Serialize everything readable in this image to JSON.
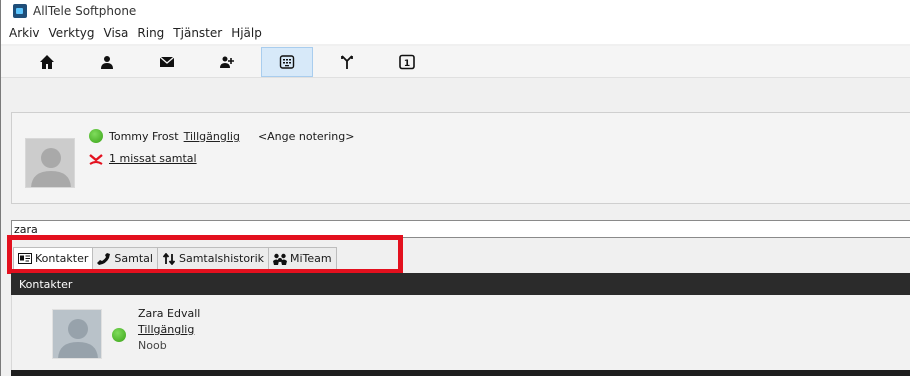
{
  "window": {
    "title": "AllTele Softphone"
  },
  "menu": [
    "Arkiv",
    "Verktyg",
    "Visa",
    "Ring",
    "Tjänster",
    "Hjälp"
  ],
  "toolbar": [
    {
      "icon": "home-icon",
      "active": false
    },
    {
      "icon": "person-icon",
      "active": false
    },
    {
      "icon": "envelope-icon",
      "active": false
    },
    {
      "icon": "add-person-icon",
      "active": false
    },
    {
      "icon": "dialpad-icon",
      "active": true
    },
    {
      "icon": "transfer-icon",
      "active": false
    },
    {
      "icon": "number-one-icon",
      "active": false,
      "label": "1"
    }
  ],
  "status": {
    "name": "Tommy Frost",
    "availability": "Tillgänglig",
    "note_placeholder": "<Ange notering>",
    "missed_calls": "1 missat samtal"
  },
  "search": {
    "value": "zara"
  },
  "tabs": [
    {
      "label": "Kontakter",
      "icon": "contacts-card-icon",
      "active": true
    },
    {
      "label": "Samtal",
      "icon": "phone-handset-icon",
      "active": false
    },
    {
      "label": "Samtalshistorik",
      "icon": "history-arrows-icon",
      "active": false
    },
    {
      "label": "MiTeam",
      "icon": "team-icon",
      "active": false
    }
  ],
  "list": {
    "header": "Kontakter",
    "contacts": [
      {
        "name": "Zara Edvall",
        "status": "Tillgänglig",
        "note": "Noob"
      }
    ]
  },
  "colors": {
    "highlight": "#e3101e",
    "header_bg": "#2b2b2b",
    "available": "#3aa318",
    "active_toolbar": "#d7e9f9"
  }
}
